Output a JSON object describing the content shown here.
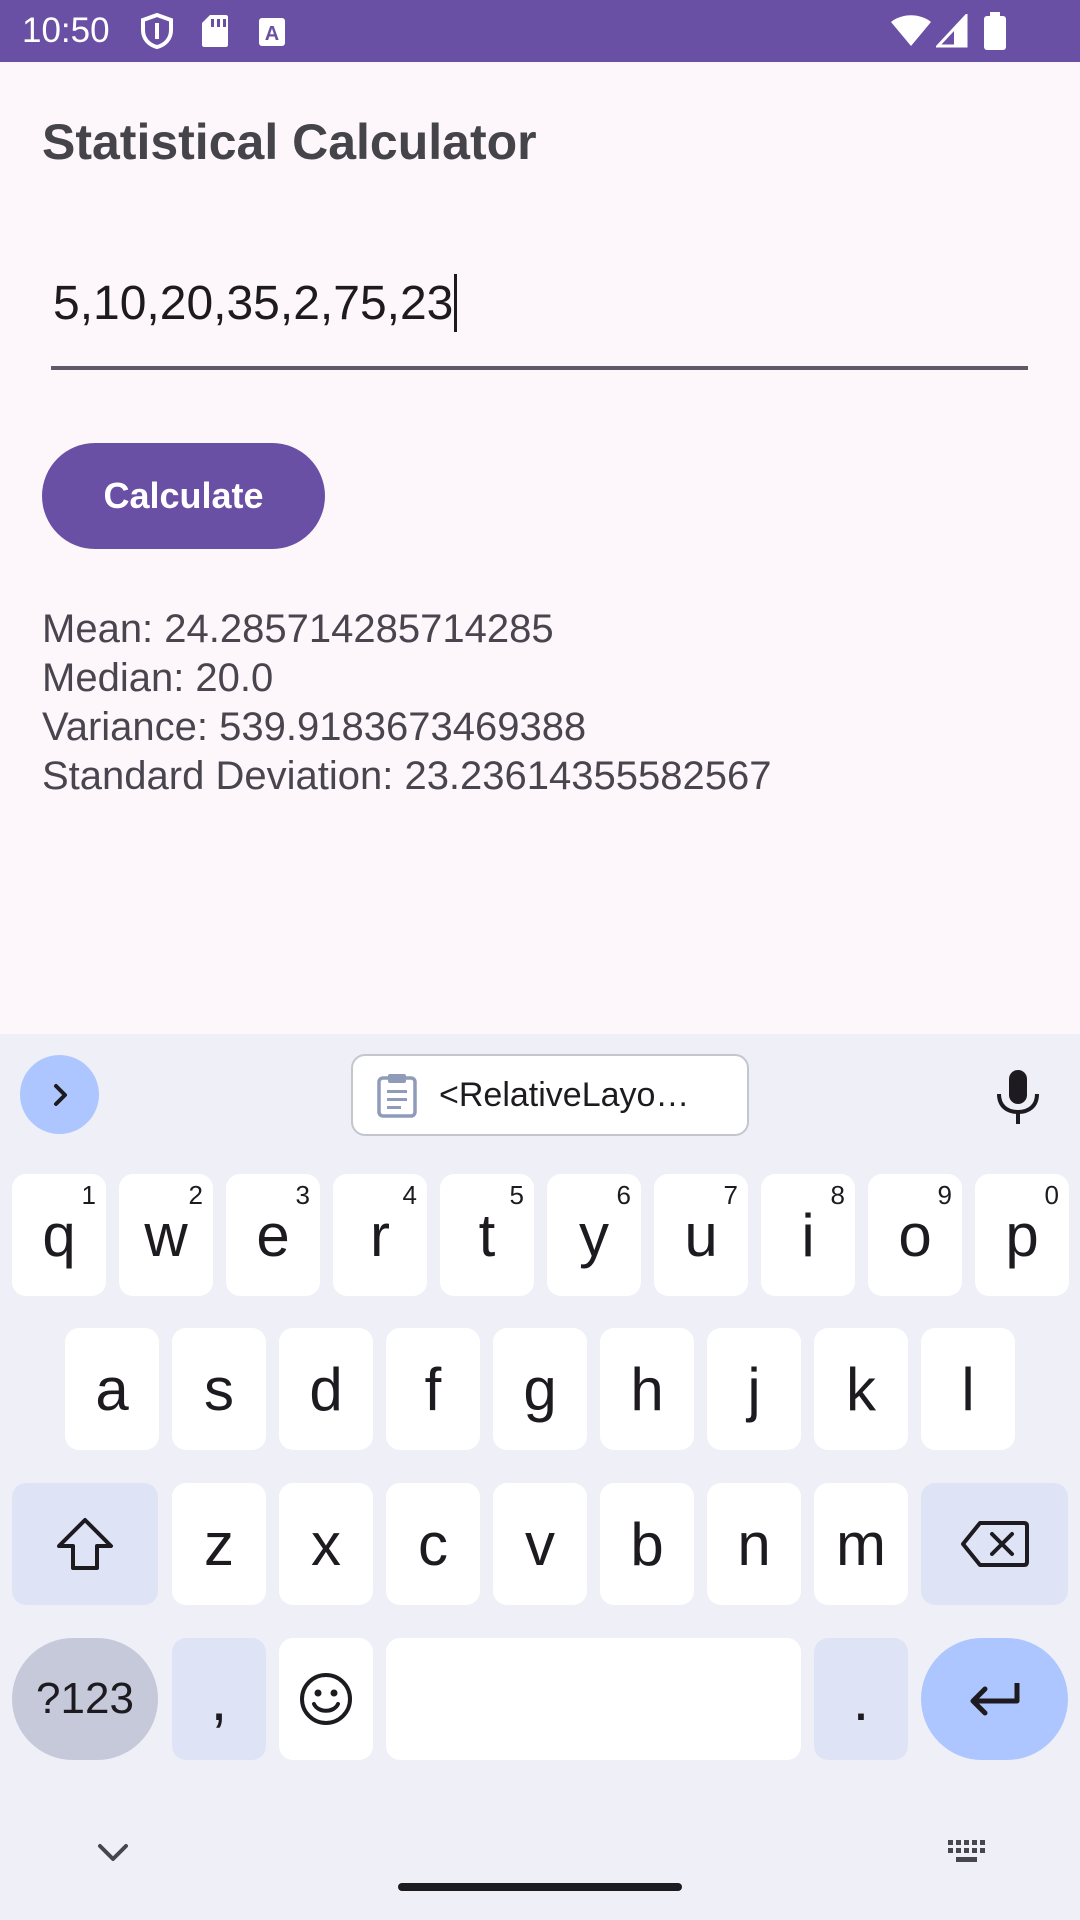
{
  "status_bar": {
    "time": "10:50",
    "bg_color": "#6a50a4",
    "left_icons": [
      "shield-icon",
      "sd-card-icon",
      "text-a-icon"
    ],
    "right_icons": [
      "wifi-icon",
      "signal-icon",
      "battery-icon"
    ]
  },
  "app": {
    "title": "Statistical Calculator",
    "input_value": "5,10,20,35,2,75,23",
    "calculate_label": "Calculate",
    "results": [
      "Mean: 24.285714285714285",
      "Median: 20.0",
      "Variance: 539.9183673469388",
      "Standard Deviation: 23.23614355582567"
    ],
    "accent_color": "#6a50a4"
  },
  "keyboard": {
    "clipboard_suggestion": "<RelativeLayo…",
    "row1": [
      {
        "key": "q",
        "hint": "1"
      },
      {
        "key": "w",
        "hint": "2"
      },
      {
        "key": "e",
        "hint": "3"
      },
      {
        "key": "r",
        "hint": "4"
      },
      {
        "key": "t",
        "hint": "5"
      },
      {
        "key": "y",
        "hint": "6"
      },
      {
        "key": "u",
        "hint": "7"
      },
      {
        "key": "i",
        "hint": "8"
      },
      {
        "key": "o",
        "hint": "9"
      },
      {
        "key": "p",
        "hint": "0"
      }
    ],
    "row2": [
      "a",
      "s",
      "d",
      "f",
      "g",
      "h",
      "j",
      "k",
      "l"
    ],
    "row3": [
      "z",
      "x",
      "c",
      "v",
      "b",
      "n",
      "m"
    ],
    "symbols_label": "?123",
    "comma_label": ",",
    "period_label": "."
  }
}
